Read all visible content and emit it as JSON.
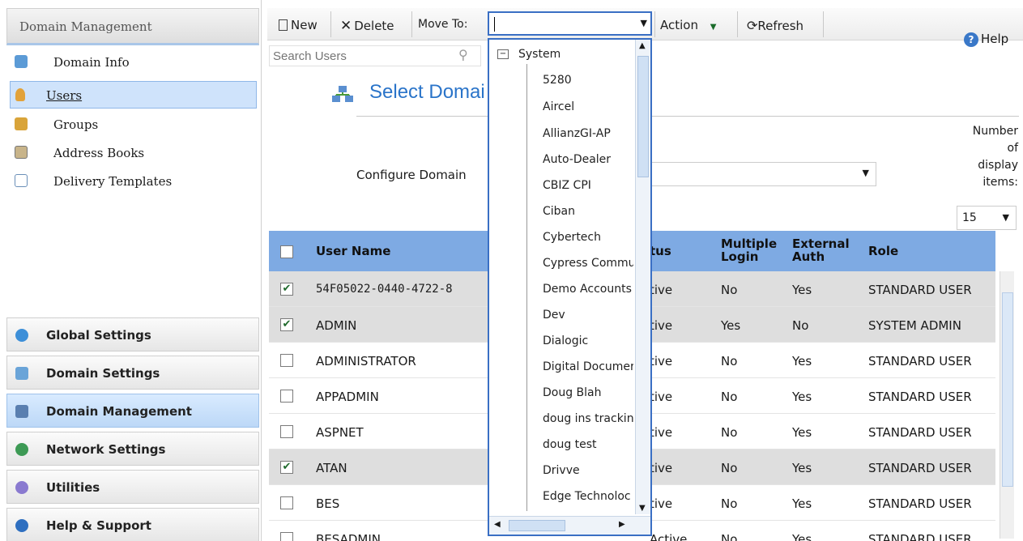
{
  "sidebar": {
    "header": "Domain Management",
    "items": [
      {
        "label": "Domain Info",
        "icon": "info-icon",
        "selected": false
      },
      {
        "label": "Users",
        "icon": "user-icon",
        "selected": true
      },
      {
        "label": "Groups",
        "icon": "group-icon",
        "selected": false
      },
      {
        "label": "Address Books",
        "icon": "address-book-icon",
        "selected": false
      },
      {
        "label": "Delivery Templates",
        "icon": "document-icon",
        "selected": false
      }
    ],
    "sections": [
      {
        "label": "Global Settings",
        "icon": "globe-icon",
        "active": false
      },
      {
        "label": "Domain Settings",
        "icon": "domain-settings-icon",
        "active": false
      },
      {
        "label": "Domain Management",
        "icon": "domain-management-icon",
        "active": true
      },
      {
        "label": "Network Settings",
        "icon": "network-icon",
        "active": false
      },
      {
        "label": "Utilities",
        "icon": "gear-icon",
        "active": false
      },
      {
        "label": "Help & Support",
        "icon": "help-icon",
        "active": false
      }
    ]
  },
  "toolbar": {
    "new_label": "New",
    "delete_label": "Delete",
    "move_to_label": "Move To:",
    "action_label": "Action",
    "refresh_label": "Refresh",
    "help_label": "Help"
  },
  "search": {
    "placeholder": "Search Users"
  },
  "title": "Select Domai",
  "configure_label": "Configure Domain",
  "display": {
    "label_lines": [
      "Number",
      "of",
      "display",
      "items:"
    ],
    "value": "15"
  },
  "table": {
    "headers": [
      "User Name",
      "tus",
      "Multiple Login",
      "External Auth",
      "Role"
    ],
    "rows": [
      {
        "checked": true,
        "name": "54F05022-0440-4722-8",
        "status": "tive",
        "multiple": "No",
        "external": "Yes",
        "role": "STANDARD USER"
      },
      {
        "checked": true,
        "name": "ADMIN",
        "status": "tive",
        "multiple": "Yes",
        "external": "No",
        "role": "SYSTEM ADMIN"
      },
      {
        "checked": false,
        "name": "ADMINISTRATOR",
        "status": "tive",
        "multiple": "No",
        "external": "Yes",
        "role": "STANDARD USER"
      },
      {
        "checked": false,
        "name": "APPADMIN",
        "status": "tive",
        "multiple": "No",
        "external": "Yes",
        "role": "STANDARD USER"
      },
      {
        "checked": false,
        "name": "ASPNET",
        "status": "tive",
        "multiple": "No",
        "external": "Yes",
        "role": "STANDARD USER"
      },
      {
        "checked": true,
        "name": "ATAN",
        "status": "tive",
        "multiple": "No",
        "external": "Yes",
        "role": "STANDARD USER"
      },
      {
        "checked": false,
        "name": "BES",
        "status": "tive",
        "multiple": "No",
        "external": "Yes",
        "role": "STANDARD USER"
      },
      {
        "checked": false,
        "name": "BESADMIN",
        "status": "Active",
        "multiple": "No",
        "external": "Yes",
        "role": "STANDARD USER"
      }
    ]
  },
  "move_to_dropdown": {
    "root": "System",
    "items": [
      "5280",
      "Aircel",
      "AllianzGI-AP",
      "Auto-Dealer",
      "CBIZ CPI",
      "Ciban",
      "Cybertech",
      "Cypress Commu",
      "Demo Accounts",
      "Dev",
      "Dialogic",
      "Digital Documer",
      "Doug Blah",
      "doug ins trackin",
      "doug test",
      "Drivve",
      "Edge Technoloc"
    ]
  },
  "colors": {
    "accent": "#2a74c9",
    "header_blue": "#7eaae3",
    "selected": "#cfe3fb"
  }
}
